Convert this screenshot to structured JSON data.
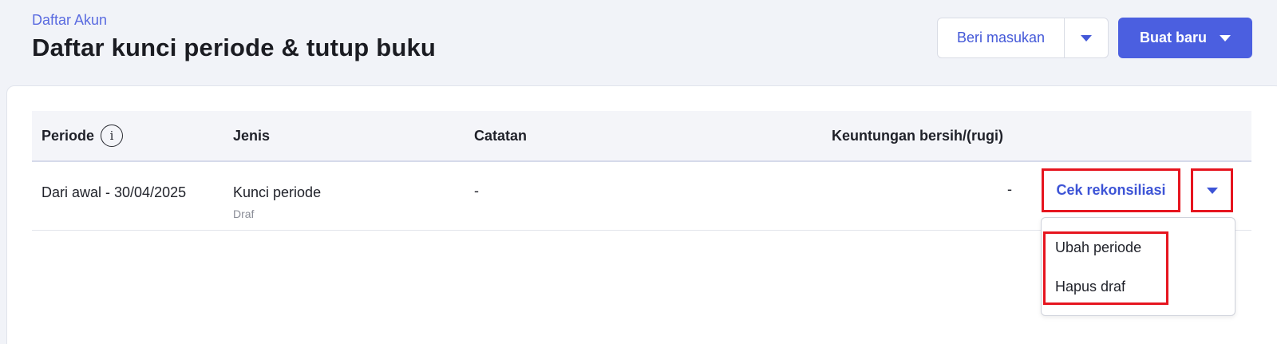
{
  "header": {
    "breadcrumb": "Daftar Akun",
    "title": "Daftar kunci periode & tutup buku",
    "feedback_label": "Beri masukan",
    "create_label": "Buat baru"
  },
  "table": {
    "columns": [
      "Periode",
      "Jenis",
      "Catatan",
      "Keuntungan bersih/(rugi)"
    ],
    "rows": [
      {
        "periode": "Dari awal - 30/04/2025",
        "jenis": "Kunci periode",
        "status": "Draf",
        "catatan": "-",
        "keuntungan": "-",
        "action_label": "Cek rekonsiliasi"
      }
    ]
  },
  "dropdown": {
    "items": [
      "Ubah periode",
      "Hapus draf"
    ]
  },
  "colors": {
    "accent": "#4b5fe0",
    "link": "#4358d8",
    "highlight": "#e6151f",
    "background": "#f1f3f8"
  },
  "icons": [
    "info-icon",
    "chevron-down-icon"
  ]
}
